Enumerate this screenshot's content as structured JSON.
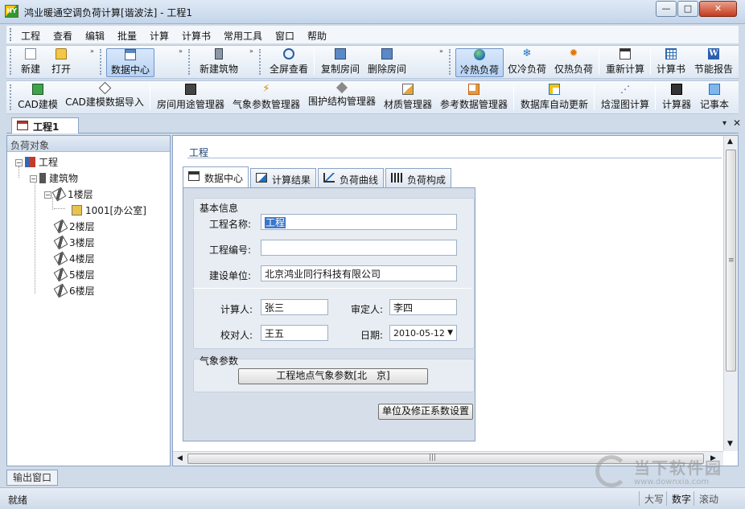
{
  "window": {
    "title": "鸿业暖通空调负荷计算[谐波法] - 工程1",
    "app_icon_text": "HY",
    "minimize_glyph": "—",
    "maximize_glyph": "□",
    "close_glyph": "✕"
  },
  "menu": [
    "工程",
    "查看",
    "编辑",
    "批量",
    "计算",
    "计算书",
    "常用工具",
    "窗口",
    "帮助"
  ],
  "toolbar1": {
    "new": "新建",
    "open": "打开",
    "data_center": "数据中心",
    "new_building": "新建筑物",
    "fullscreen_view": "全屏查看",
    "copy_room": "复制房间",
    "delete_room": "删除房间",
    "cooling_heating_load": "冷热负荷",
    "cooling_load_only": "仅冷负荷",
    "heating_load_only": "仅热负荷",
    "recalculate": "重新计算",
    "calc_book": "计算书",
    "energy_report": "节能报告"
  },
  "toolbar2": {
    "cad_model": "CAD建模",
    "cad_import": "CAD建模数据导入",
    "room_usage": "房间用途管理器",
    "weather_params": "气象参数管理器",
    "envelope": "围护结构管理器",
    "material": "材质管理器",
    "reference_data": "参考数据管理器",
    "db_auto_update": "数据库自动更新",
    "psychrometric": "焓湿图计算",
    "calculator": "计算器",
    "notepad": "记事本"
  },
  "overflow_glyph": "»",
  "doc_tab": {
    "label": "工程1",
    "dropdown_glyph": "▾",
    "close_glyph": "✕"
  },
  "tree": {
    "header": "负荷对象",
    "project": "工程",
    "building": "建筑物",
    "floor1": "1楼层",
    "room": "1001[办公室]",
    "floor2": "2楼层",
    "floor3": "3楼层",
    "floor4": "4楼层",
    "floor5": "5楼层",
    "floor6": "6楼层",
    "collapse_glyph": "−"
  },
  "content": {
    "breadcrumb": "工程",
    "tabs": [
      "数据中心",
      "计算结果",
      "负荷曲线",
      "负荷构成"
    ],
    "basic_info_title": "基本信息",
    "project_name_label": "工程名称:",
    "project_name_value": "工程",
    "project_number_label": "工程编号:",
    "project_number_value": "",
    "builder_label": "建设单位:",
    "builder_value": "北京鸿业同行科技有限公司",
    "calculator_label": "计算人:",
    "calculator_value": "张三",
    "approver_label": "审定人:",
    "approver_value": "李四",
    "checker_label": "校对人:",
    "checker_value": "王五",
    "date_label": "日期:",
    "date_value": "2010-05-12",
    "date_arrow": "▼",
    "weather_title": "气象参数",
    "weather_button": "工程地点气象参数[北　京]",
    "units_button": "单位及修正系数设置"
  },
  "scrollbar": {
    "up": "▲",
    "down": "▼",
    "left": "◀",
    "right": "▶",
    "v_grip": "≡",
    "h_grip": "|||"
  },
  "output_tab": "输出窗口",
  "status": {
    "text": "就绪",
    "caps": "大写",
    "num": "数字",
    "scroll": "滚动"
  },
  "watermark": {
    "text": "当下软件园",
    "url": "www.downxia.com"
  }
}
